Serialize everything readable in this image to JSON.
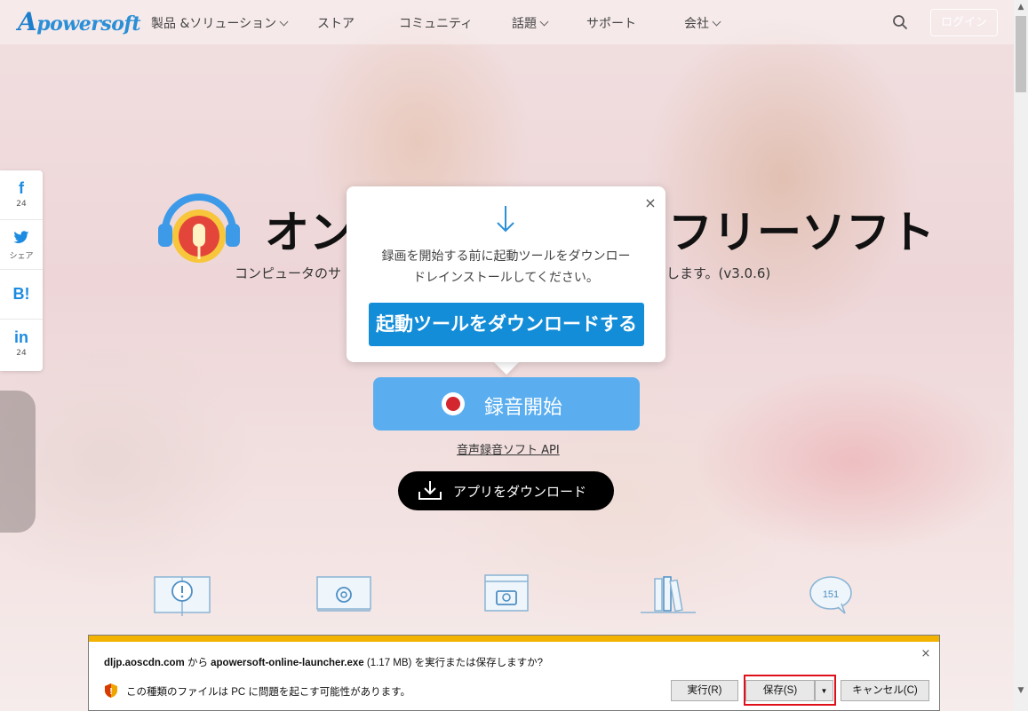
{
  "nav": {
    "logo_text": "powersoft",
    "logo_initial": "A",
    "items": [
      {
        "label": "製品 &ソリューション",
        "dropdown": true
      },
      {
        "label": "ストア",
        "dropdown": false
      },
      {
        "label": "コミュニティ",
        "dropdown": false
      },
      {
        "label": "話題",
        "dropdown": true
      },
      {
        "label": "サポート",
        "dropdown": false
      },
      {
        "label": "会社",
        "dropdown": true
      }
    ],
    "login_label": "ログイン"
  },
  "share": {
    "facebook": {
      "icon": "f",
      "count": "24"
    },
    "twitter": {
      "icon": "twitter-bird",
      "label": "シェア"
    },
    "hatena": {
      "icon": "B!"
    },
    "linkedin": {
      "icon": "in",
      "count": "24"
    }
  },
  "hero": {
    "title_left": "オン",
    "title_right": "フリーソフト",
    "subtitle_left": "コンピュータのサ",
    "subtitle_right": "します。(v3.0.6)"
  },
  "popup": {
    "message_line1": "録画を開始する前に起動ツールをダウンロー",
    "message_line2": "ドレインストールしてください。",
    "button_label": "起動ツールをダウンロードする",
    "close_label": "×"
  },
  "record": {
    "label": "録音開始"
  },
  "api_link": "音声録音ソフト API",
  "download_app": {
    "label": "アプリをダウンロード"
  },
  "features": {
    "bubble_count": "151"
  },
  "download_bar": {
    "domain": "dljp.aoscdn.com",
    "from_text": " から ",
    "filename": "apowersoft-online-launcher.exe",
    "size_text": " (1.17 MB) を実行または保存しますか?",
    "warning": "この種類のファイルは PC に問題を起こす可能性があります。",
    "run_label": "実行(R)",
    "save_label": "保存(S)",
    "cancel_label": "キャンセル(C)",
    "close_label": "×"
  },
  "colors": {
    "accent_blue": "#148dd8",
    "record_blue": "#5aaef0",
    "warning_bar": "#f3b100",
    "highlight_red": "#e0101a"
  }
}
